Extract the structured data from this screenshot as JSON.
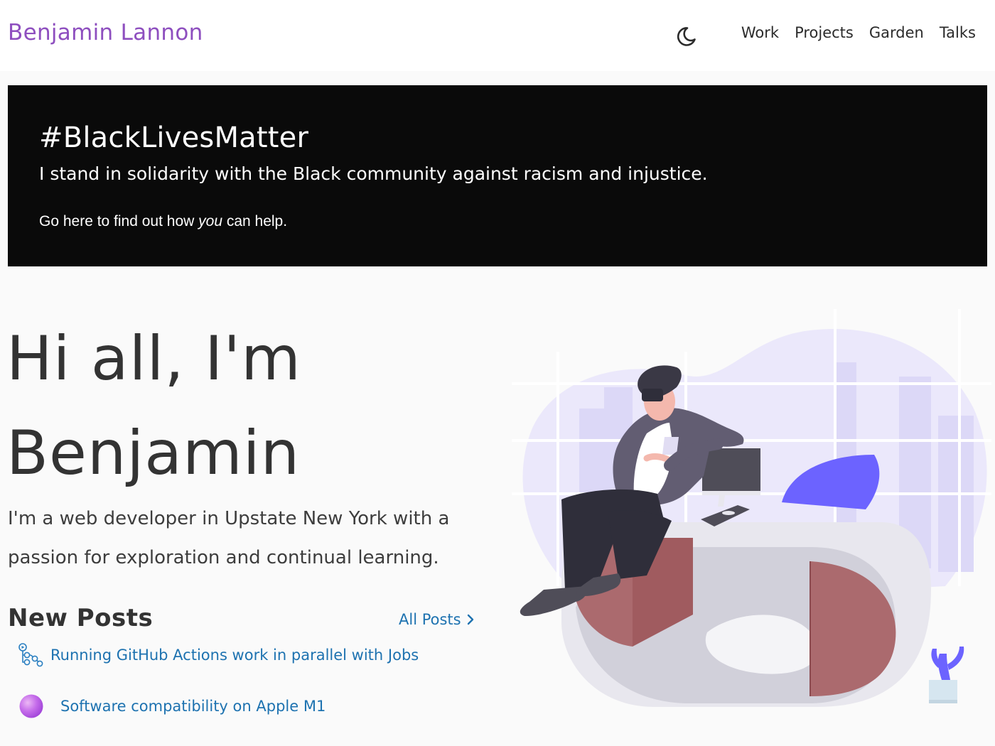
{
  "header": {
    "brand": "Benjamin Lannon",
    "theme_icon": "moon-icon",
    "nav": [
      {
        "label": "Work"
      },
      {
        "label": "Projects"
      },
      {
        "label": "Garden"
      },
      {
        "label": "Talks"
      }
    ]
  },
  "banner": {
    "title": "#BlackLivesMatter",
    "text": "I stand in solidarity with the Black community against racism and injustice.",
    "link_before": "Go here to find out how ",
    "link_emphasis": "you",
    "link_after": " can help."
  },
  "hero": {
    "line1": "Hi all, I'm",
    "line2": "Benjamin",
    "intro": "I'm a web developer in Upstate New York with a passion for exploration and continual learning."
  },
  "posts": {
    "heading": "New Posts",
    "all_label": "All Posts",
    "items": [
      {
        "title": "Running GitHub Actions work in parallel with Jobs",
        "icon": "github-actions-icon"
      },
      {
        "title": "Software compatibility on Apple M1",
        "icon": "apple-m1-icon"
      }
    ]
  },
  "colors": {
    "brand": "#8e4fbf",
    "link": "#1d72b0",
    "banner_bg": "#0a0a0a",
    "accent_purple": "#6c63ff"
  },
  "illustration": {
    "icon": "developer-at-desk-illustration"
  }
}
